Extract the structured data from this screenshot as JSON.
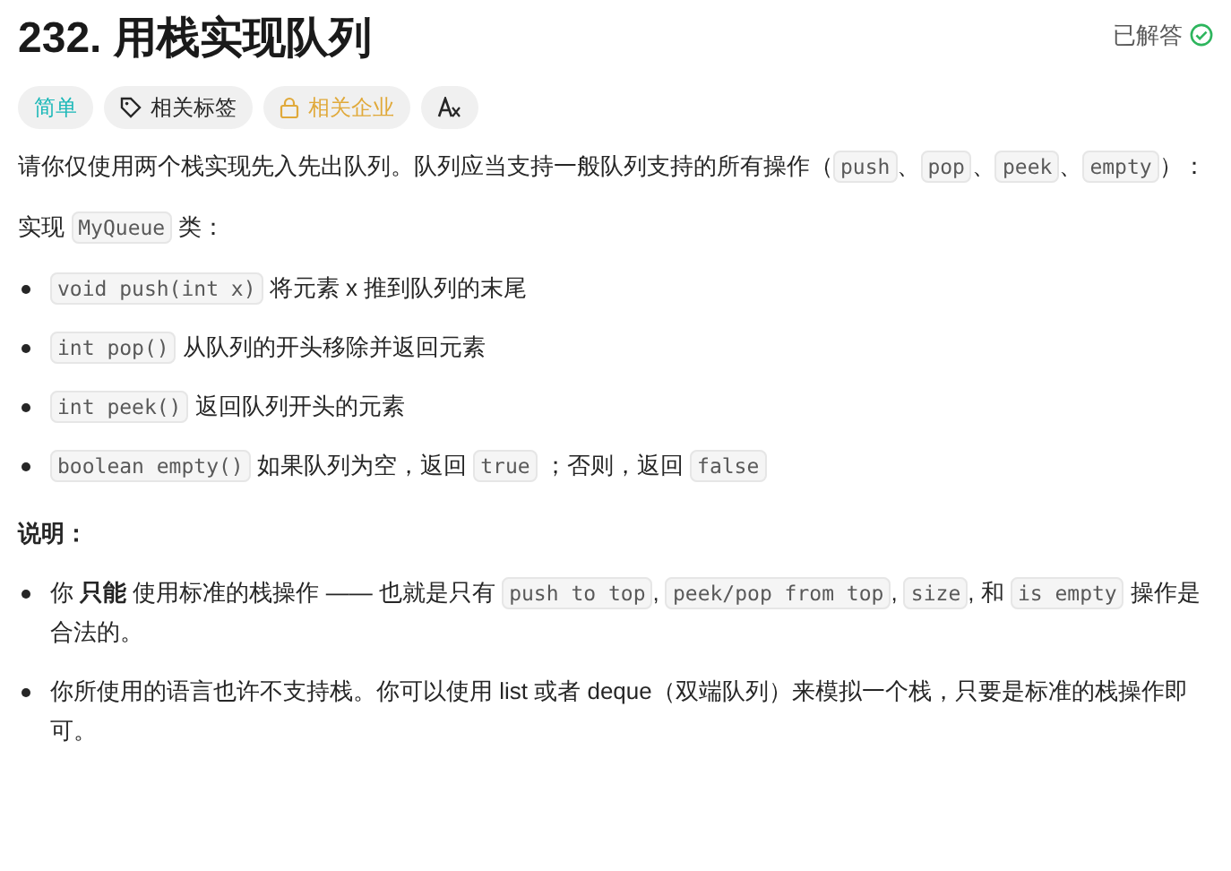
{
  "title": {
    "number": "232.",
    "text": "用栈实现队列"
  },
  "status": {
    "label": "已解答",
    "solved": true
  },
  "tags": [
    {
      "kind": "difficulty",
      "label": "简单"
    },
    {
      "kind": "topics",
      "label": "相关标签"
    },
    {
      "kind": "locked",
      "label": "相关企业"
    },
    {
      "kind": "translate"
    }
  ],
  "description": [
    {
      "kind": "para",
      "segments": [
        {
          "kind": "text",
          "text": "请你仅使用两个栈实现先入先出队列。队列应当支持一般队列支持的所有操作（"
        },
        {
          "kind": "code",
          "text": "push"
        },
        {
          "kind": "text",
          "text": "、"
        },
        {
          "kind": "code",
          "text": "pop"
        },
        {
          "kind": "text",
          "text": "、"
        },
        {
          "kind": "code",
          "text": "peek"
        },
        {
          "kind": "text",
          "text": "、"
        },
        {
          "kind": "code",
          "text": "empty"
        },
        {
          "kind": "text",
          "text": "）："
        }
      ]
    },
    {
      "kind": "para",
      "segments": [
        {
          "kind": "text",
          "text": "实现 "
        },
        {
          "kind": "code",
          "text": "MyQueue"
        },
        {
          "kind": "text",
          "text": " 类："
        }
      ]
    },
    {
      "kind": "bullet",
      "segments": [
        {
          "kind": "code",
          "text": "void push(int x)"
        },
        {
          "kind": "text",
          "text": " 将元素 x 推到队列的末尾"
        }
      ]
    },
    {
      "kind": "bullet",
      "segments": [
        {
          "kind": "code",
          "text": "int pop()"
        },
        {
          "kind": "text",
          "text": " 从队列的开头移除并返回元素"
        }
      ]
    },
    {
      "kind": "bullet",
      "segments": [
        {
          "kind": "code",
          "text": "int peek()"
        },
        {
          "kind": "text",
          "text": " 返回队列开头的元素"
        }
      ]
    },
    {
      "kind": "bullet",
      "segments": [
        {
          "kind": "code",
          "text": "boolean empty()"
        },
        {
          "kind": "text",
          "text": " 如果队列为空，返回 "
        },
        {
          "kind": "code",
          "text": "true"
        },
        {
          "kind": "text",
          "text": " ；否则，返回 "
        },
        {
          "kind": "code",
          "text": "false"
        }
      ]
    },
    {
      "kind": "heading",
      "segments": [
        {
          "kind": "text",
          "text": "说明："
        }
      ]
    },
    {
      "kind": "bullet",
      "segments": [
        {
          "kind": "text",
          "text": "你 **只能** 使用标准的栈操作 —— 也就是只有 "
        },
        {
          "kind": "code",
          "text": "push to top"
        },
        {
          "kind": "text",
          "text": ", "
        },
        {
          "kind": "code",
          "text": "peek/pop from top"
        },
        {
          "kind": "text",
          "text": ", "
        },
        {
          "kind": "code",
          "text": "size"
        },
        {
          "kind": "text",
          "text": ", 和 "
        },
        {
          "kind": "code",
          "text": "is empty"
        },
        {
          "kind": "text",
          "text": " 操作是合法的。"
        }
      ]
    },
    {
      "kind": "bullet",
      "segments": [
        {
          "kind": "text",
          "text": "你所使用的语言也许不支持栈。你可以使用 list 或者 deque（双端队列）来模拟一个栈，只要是标准的栈操作即可。"
        }
      ]
    }
  ]
}
